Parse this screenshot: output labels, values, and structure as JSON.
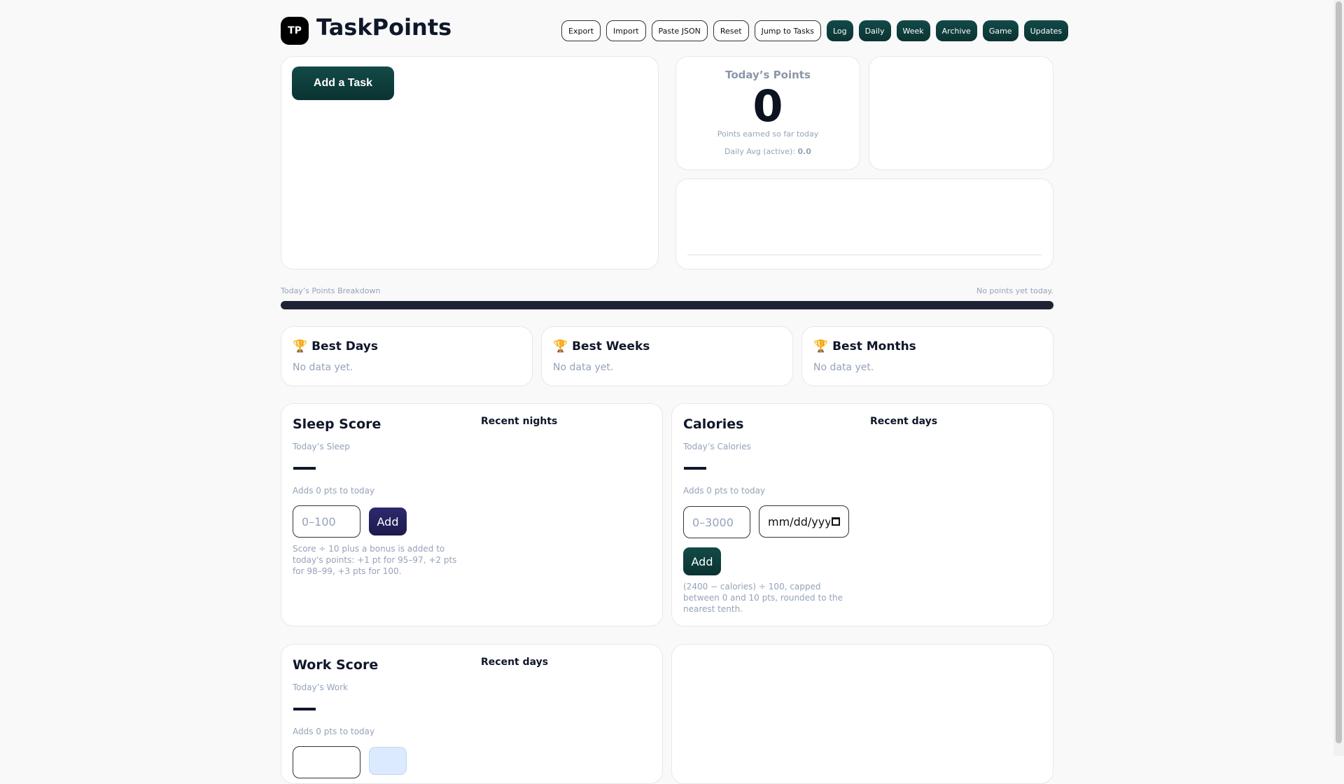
{
  "header": {
    "logo": "TP",
    "title": "TaskPoints",
    "buttons": [
      "Export",
      "Import",
      "Paste JSON",
      "Reset",
      "Jump to Tasks",
      "Log",
      "Daily",
      "Week",
      "Archive",
      "Game",
      "Updates"
    ]
  },
  "tasks": {
    "add_label": "Add a Task"
  },
  "points": {
    "title": "Today’s Points",
    "value": "0",
    "caption": "Points earned so far today",
    "avg_label": "Daily Avg (active):",
    "avg_value": "0.0"
  },
  "breakdown": {
    "label": "Today’s Points Breakdown",
    "status": "No points yet today."
  },
  "best": [
    {
      "title": "Best Days",
      "empty": "No data yet."
    },
    {
      "title": "Best Weeks",
      "empty": "No data yet."
    },
    {
      "title": "Best Months",
      "empty": "No data yet."
    }
  ],
  "sleep": {
    "title": "Sleep Score",
    "sub": "Today’s Sleep",
    "adds": "Adds 0 pts to today",
    "placeholder": "0–100",
    "add": "Add",
    "hint": "Score ÷ 10 plus a bonus is added to today's points: +1 pt for 95–97, +2 pts for 98–99, +3 pts for 100.",
    "recent": "Recent nights"
  },
  "calories": {
    "title": "Calories",
    "sub": "Today’s Calories",
    "adds": "Adds 0 pts to today",
    "placeholder": "0–3000",
    "date_placeholder": "mm/dd/yyyy",
    "add": "Add",
    "hint": "(2400 − calories) ÷ 100, capped between 0 and 10 pts, rounded to the nearest tenth.",
    "recent": "Recent days"
  },
  "work": {
    "title": "Work Score",
    "sub": "Today’s Work",
    "adds": "Adds 0 pts to today",
    "recent": "Recent days"
  },
  "colors": {
    "accent": "#0f3f3d",
    "sleep_button": "#24225e",
    "bar": "#1e2235"
  }
}
